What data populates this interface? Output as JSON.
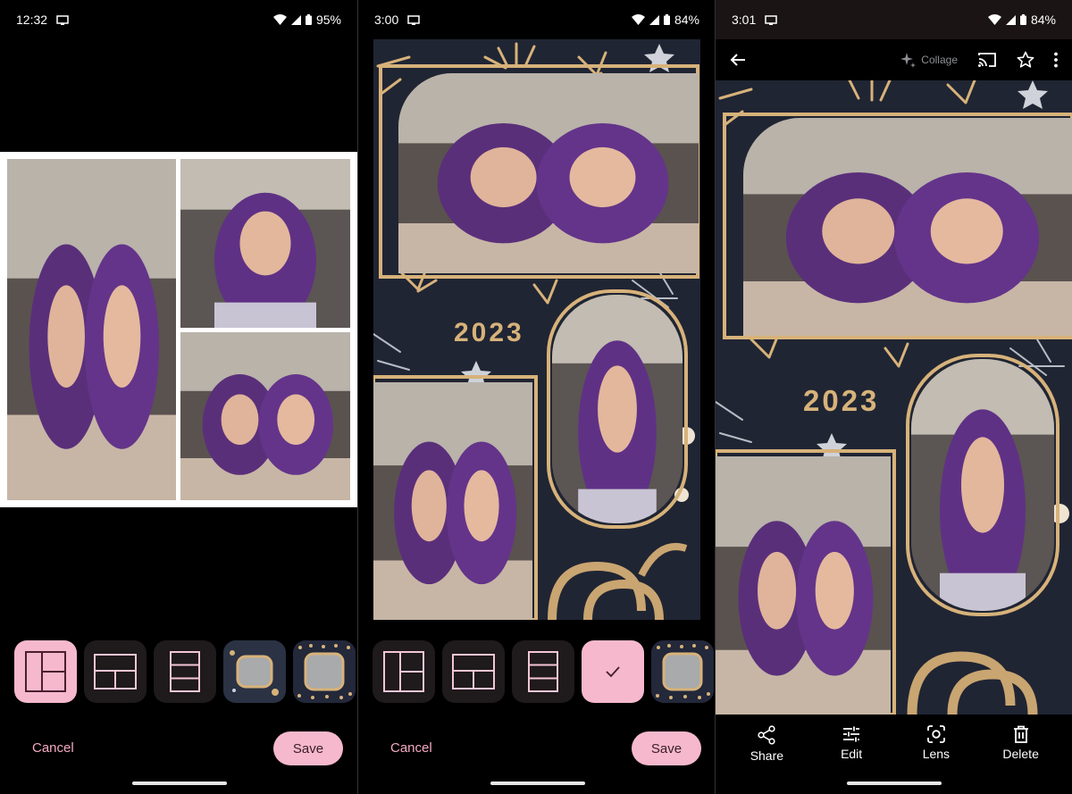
{
  "screens": [
    {
      "status": {
        "time": "12:32",
        "battery": "95%"
      }
    },
    {
      "status": {
        "time": "3:00",
        "battery": "84%"
      }
    },
    {
      "status": {
        "time": "3:01",
        "battery": "84%"
      }
    }
  ],
  "editor": {
    "cancel_label": "Cancel",
    "save_label": "Save",
    "year_text": "2023"
  },
  "viewer": {
    "collage_tag": "Collage",
    "actions": {
      "share": "Share",
      "edit": "Edit",
      "lens": "Lens",
      "delete": "Delete"
    }
  },
  "colors": {
    "accent": "#f6b8cd",
    "accent_text": "#f4a9c2",
    "theme_bg": "#202533",
    "gold": "#d7b27a"
  }
}
